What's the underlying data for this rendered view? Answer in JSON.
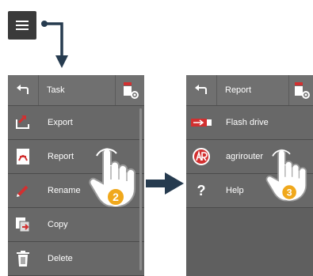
{
  "menu_button": {
    "icon": "hamburger-menu-icon"
  },
  "left_panel": {
    "title": "Task",
    "items": [
      {
        "label": "Export",
        "icon": "export-icon"
      },
      {
        "label": "Report",
        "icon": "pdf-report-icon"
      },
      {
        "label": "Rename",
        "icon": "pencil-icon"
      },
      {
        "label": "Copy",
        "icon": "copy-icon"
      },
      {
        "label": "Delete",
        "icon": "trash-icon"
      }
    ],
    "step": "2"
  },
  "right_panel": {
    "title": "Report",
    "items": [
      {
        "label": "Flash drive",
        "icon": "usb-icon"
      },
      {
        "label": "agrirouter",
        "icon": "agrirouter-icon"
      },
      {
        "label": "Help",
        "icon": "help-icon"
      }
    ],
    "step": "3"
  },
  "colors": {
    "panel": "#5f5f5f",
    "header": "#707070",
    "badge": "#f0a81c",
    "accent_red": "#d23030"
  }
}
